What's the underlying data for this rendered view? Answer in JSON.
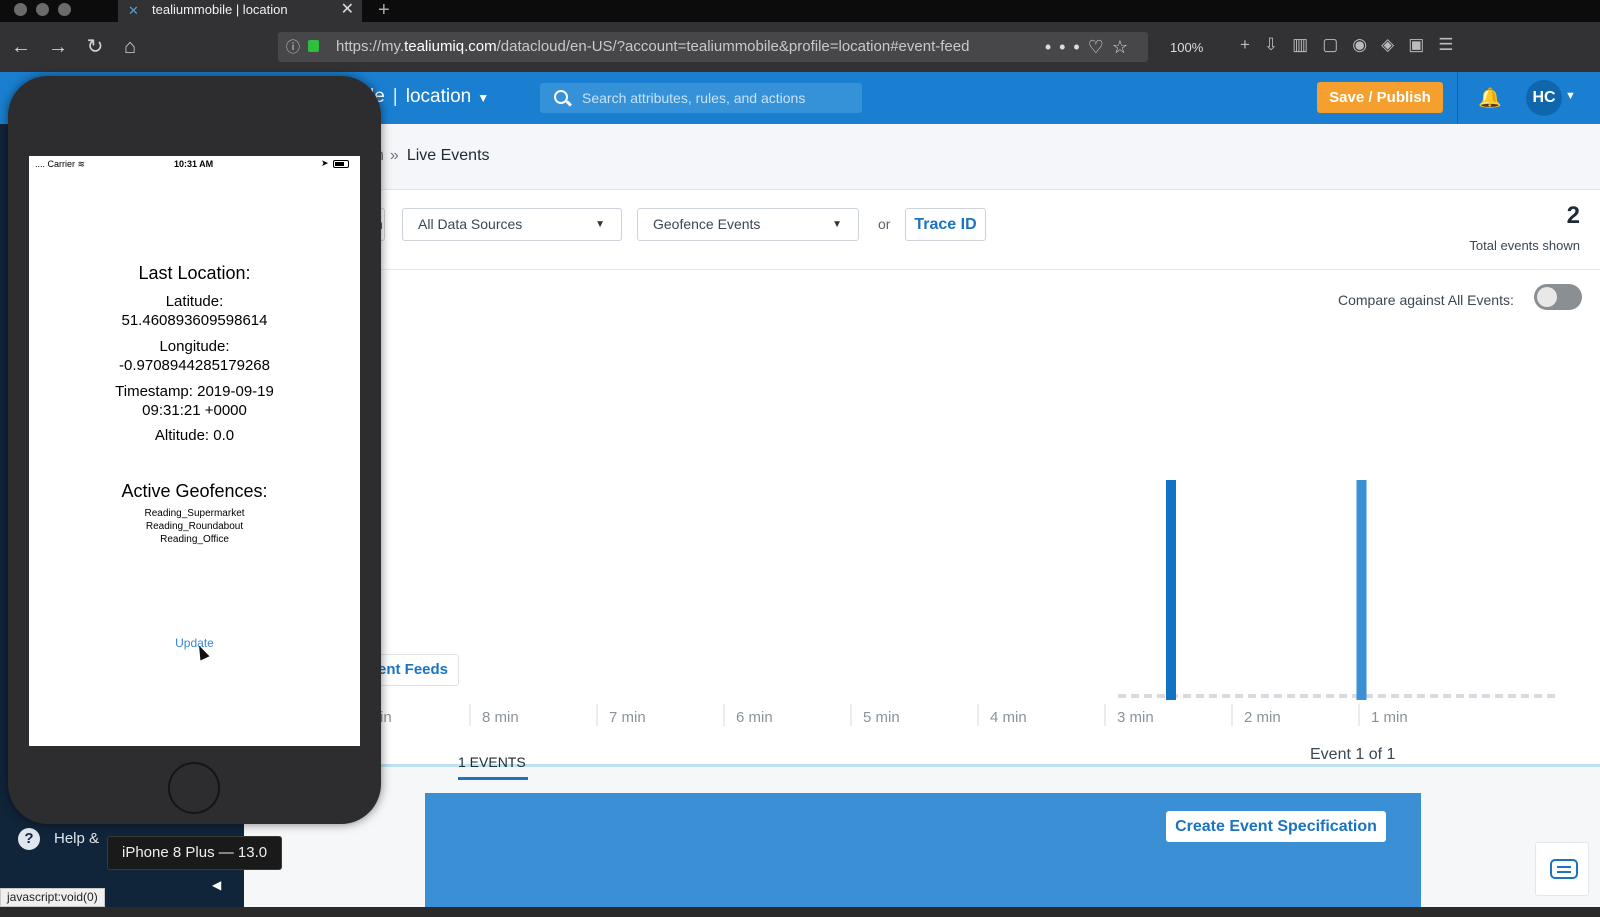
{
  "browser": {
    "tab_title": "tealiummobile | location",
    "url_prefix": "https://my.",
    "url_domain": "tealiumiq.com",
    "url_rest": "/datacloud/en-US/?account=tealiummobile&profile=location#event-feed",
    "zoom": "100%",
    "status_url": "javascript:void(0)"
  },
  "header": {
    "profile_partial": "le",
    "profile_name": "location",
    "search_placeholder": "Search attributes, rules, and actions",
    "save_label": "Save / Publish",
    "avatar_initials": "HC"
  },
  "breadcrumb": {
    "partial": "n",
    "current": "Live Events"
  },
  "filters": {
    "partial_label": "n",
    "data_sources": "All Data Sources",
    "event_type": "Geofence Events",
    "or_text": "or",
    "trace_label": "Trace ID",
    "total_events": "2",
    "total_label": "Total events shown"
  },
  "chart": {
    "compare_label": "Compare against All Events:",
    "compare_enabled": false
  },
  "chart_data": {
    "type": "bar",
    "categories": [
      "in",
      "9 min",
      "8 min",
      "7 min",
      "6 min",
      "5 min",
      "4 min",
      "3 min",
      "2 min",
      "1 min"
    ],
    "x_label_ticks": [
      "in",
      "9 min",
      "8 min",
      "7 min",
      "6 min",
      "5 min",
      "4 min",
      "3 min",
      "2 min",
      "1 min"
    ],
    "bars": [
      {
        "x_minutes_ago": 3.0,
        "value": 1,
        "color": "#1273c2"
      },
      {
        "x_minutes_ago": 1.5,
        "value": 1,
        "color": "#3b8fd4"
      }
    ],
    "ylim": [
      0,
      1
    ]
  },
  "feeds": {
    "tab_label": "ent Feeds",
    "events_tab": "1 EVENTS",
    "event_count": "Event 1 of 1",
    "create_label": "Create Event Specification"
  },
  "sidebar": {
    "help_label": "Help &"
  },
  "phone": {
    "carrier": "Carrier",
    "time": "10:31 AM",
    "last_location_title": "Last Location:",
    "latitude_label": "Latitude:",
    "latitude_value": "51.460893609598614",
    "longitude_label": "Longitude:",
    "longitude_value": "-0.9708944285179268",
    "timestamp_line1": "Timestamp: 2019-09-19",
    "timestamp_line2": "09:31:21 +0000",
    "altitude": "Altitude: 0.0",
    "geofences_title": "Active Geofences:",
    "geofences": [
      "Reading_Supermarket",
      "Reading_Roundabout",
      "Reading_Office"
    ],
    "update_label": "Update",
    "simulator_label": "iPhone 8 Plus — 13.0"
  },
  "colors": {
    "brand_blue": "#1a7fd0",
    "save_orange": "#f5a02e",
    "bar_dark": "#1273c2",
    "bar_light": "#3b8fd4"
  }
}
